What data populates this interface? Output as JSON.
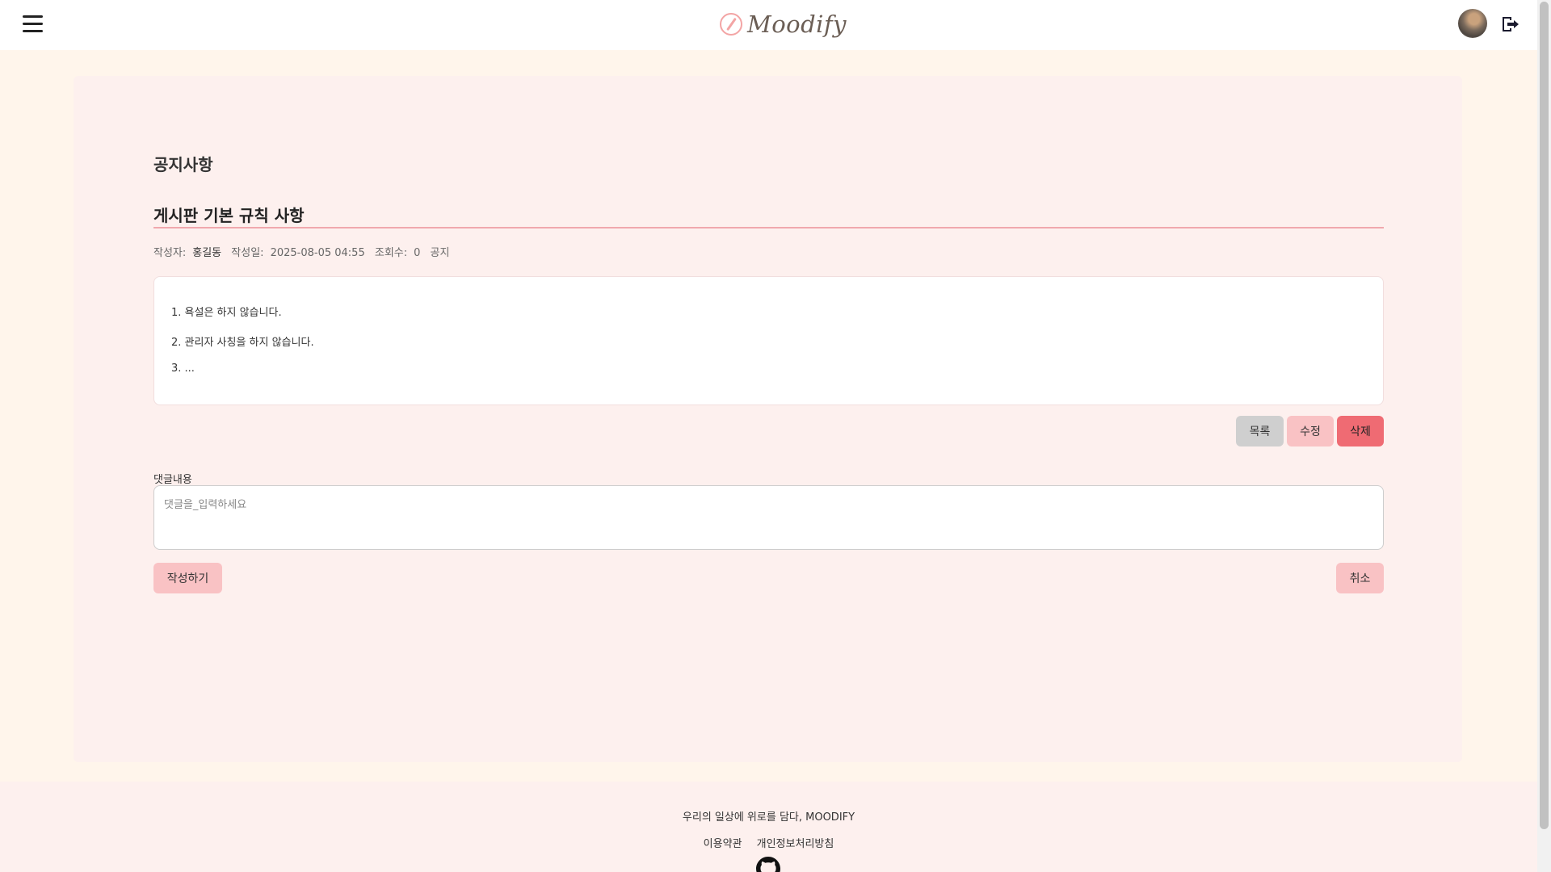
{
  "header": {
    "logo_text": "Moodify",
    "menu_icon": "hamburger-menu-icon",
    "avatar_icon": "user-avatar",
    "logout_icon": "logout-icon"
  },
  "page": {
    "section_title": "공지사항",
    "post": {
      "title": "게시판 기본 규칙 사항",
      "author_label": "작성자:",
      "author": "홍길동",
      "date_label": "작성일:",
      "date": "2025-08-05 04:55",
      "views_label": "조회수:",
      "views": "0",
      "category": "공지",
      "content_lines": [
        "1. 욕설은 하지 않습니다.",
        "2. 관리자 사칭을 하지 않습니다.",
        "3. ..."
      ]
    },
    "actions": {
      "list_label": "목록",
      "edit_label": "수정",
      "delete_label": "삭제"
    },
    "comment": {
      "label": "댓글내용",
      "placeholder": "댓글을_입력하세요",
      "value": "",
      "submit_label": "작성하기",
      "cancel_label": "취소"
    }
  },
  "footer": {
    "tagline": "우리의 일상에 위로를 담다, MOODIFY",
    "links": [
      "이용약관",
      "개인정보처리방침"
    ],
    "github_icon": "github-icon"
  },
  "colors": {
    "page_bg": "#fff5eb",
    "card_bg": "#fdf0ee",
    "accent_pink": "#f9c2c4",
    "danger": "#ef6b73",
    "neutral_button": "#cfcfcf",
    "title_rule": "#f0a8ad"
  }
}
